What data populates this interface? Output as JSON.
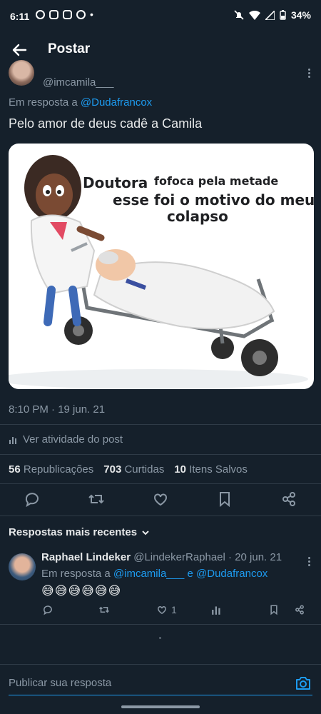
{
  "status_bar": {
    "time": "6:11",
    "battery": "34%"
  },
  "header": {
    "title": "Postar"
  },
  "post": {
    "handle": "@imcamila___",
    "reply_prefix": "Em resposta a",
    "reply_to": "@Dudafrancox",
    "text": "Pelo amor de deus cadê a Camila",
    "image_text": {
      "line1": "Doutora",
      "line2": "fofoca pela metade",
      "line3": "esse foi o motivo do meu",
      "line4": "colapso"
    },
    "timestamp": "8:10 PM · 19 jun. 21",
    "activity_label": "Ver atividade do post",
    "stats": {
      "reposts_count": "56",
      "reposts_label": "Republicações",
      "likes_count": "703",
      "likes_label": "Curtidas",
      "saves_count": "10",
      "saves_label": "Itens Salvos"
    }
  },
  "replies_sort": {
    "label": "Respostas mais recentes"
  },
  "reply": {
    "name": "Raphael Lindeker",
    "handle_date": "@LindekerRaphael · 20 jun. 21",
    "reply_prefix": "Em resposta a",
    "reply_to_1": "@imcamila___",
    "conj": "e",
    "reply_to_2": "@Dudafrancox",
    "text": "😅😅😅😅😅😅",
    "likes": "1"
  },
  "compose": {
    "placeholder": "Publicar sua resposta"
  },
  "colors": {
    "background": "#15202b",
    "accent": "#1d9bf0",
    "muted": "#8b98a5",
    "text": "#e7e9ea"
  }
}
